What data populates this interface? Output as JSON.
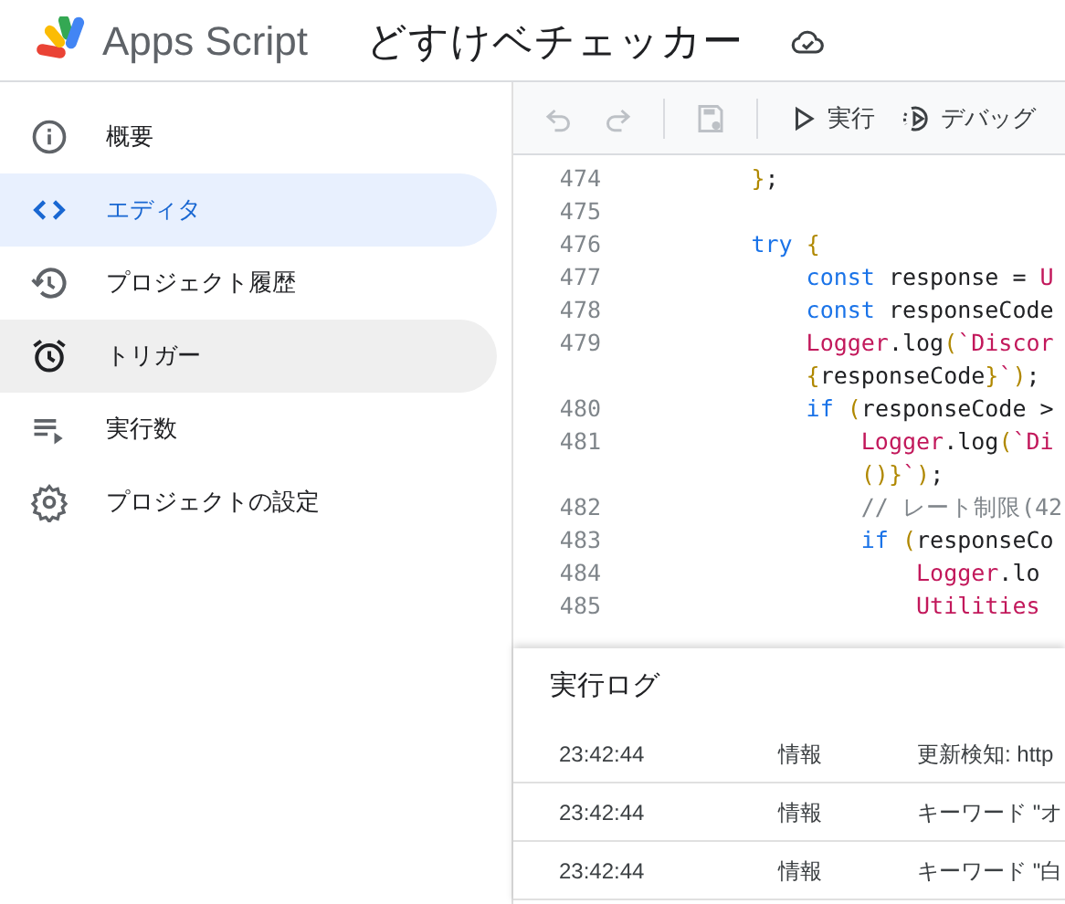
{
  "header": {
    "product": "Apps Script",
    "project_title": "どすけベチェッカー"
  },
  "sidebar": {
    "items": [
      {
        "label": "概要",
        "selected": false
      },
      {
        "label": "エディタ",
        "selected": true
      },
      {
        "label": "プロジェクト履歴",
        "selected": false
      },
      {
        "label": "トリガー",
        "selected": false,
        "hovered": true
      },
      {
        "label": "実行数",
        "selected": false
      },
      {
        "label": "プロジェクトの設定",
        "selected": false
      }
    ]
  },
  "toolbar": {
    "undo": {
      "disabled": true
    },
    "redo": {
      "disabled": true
    },
    "save": {
      "disabled": true
    },
    "run": {
      "label": "実行"
    },
    "debug": {
      "label": "デバッグ"
    }
  },
  "code": {
    "lines": [
      {
        "number": "474",
        "tokens": [
          {
            "kind": "bracket",
            "text": "        }"
          },
          {
            "kind": "plain",
            "text": ";"
          }
        ]
      },
      {
        "number": "475"
      },
      {
        "number": "476",
        "tokens": [
          {
            "kind": "keyword",
            "text": "        try"
          },
          {
            "kind": "bracket",
            "text": " {"
          }
        ]
      },
      {
        "number": "477",
        "tokens": [
          {
            "kind": "keyword",
            "text": "            const"
          },
          {
            "kind": "plain",
            "text": " response = "
          },
          {
            "kind": "ident",
            "text": "U"
          }
        ]
      },
      {
        "number": "478",
        "tokens": [
          {
            "kind": "keyword",
            "text": "            const"
          },
          {
            "kind": "plain",
            "text": " responseCode"
          }
        ]
      },
      {
        "number": "479",
        "tokens": [
          {
            "kind": "ident",
            "text": "            Logger"
          },
          {
            "kind": "plain",
            "text": ".log"
          },
          {
            "kind": "bracket",
            "text": "("
          },
          {
            "kind": "ident",
            "text": "`Discor"
          }
        ]
      },
      {
        "tokens": [
          {
            "kind": "bracket",
            "text": "            {"
          },
          {
            "kind": "plain",
            "text": "responseCode"
          },
          {
            "kind": "bracket",
            "text": "}"
          },
          {
            "kind": "ident",
            "text": "`"
          },
          {
            "kind": "bracket",
            "text": ")"
          },
          {
            "kind": "plain",
            "text": ";"
          }
        ]
      },
      {
        "number": "480",
        "tokens": [
          {
            "kind": "keyword",
            "text": "            if"
          },
          {
            "kind": "bracket",
            "text": " ("
          },
          {
            "kind": "plain",
            "text": "responseCode >"
          }
        ]
      },
      {
        "number": "481",
        "tokens": [
          {
            "kind": "ident",
            "text": "                Logger"
          },
          {
            "kind": "plain",
            "text": ".log"
          },
          {
            "kind": "bracket",
            "text": "("
          },
          {
            "kind": "ident",
            "text": "`Di"
          }
        ]
      },
      {
        "tokens": [
          {
            "kind": "bracket",
            "text": "                ()}"
          },
          {
            "kind": "ident",
            "text": "`"
          },
          {
            "kind": "bracket",
            "text": ")"
          },
          {
            "kind": "plain",
            "text": ";"
          }
        ]
      },
      {
        "number": "482",
        "tokens": [
          {
            "kind": "comment",
            "text": "                // レート制限(42"
          }
        ]
      },
      {
        "number": "483",
        "tokens": [
          {
            "kind": "keyword",
            "text": "                if"
          },
          {
            "kind": "bracket",
            "text": " ("
          },
          {
            "kind": "plain",
            "text": "responseCo"
          }
        ]
      },
      {
        "number": "484",
        "tokens": [
          {
            "kind": "ident",
            "text": "                    Logger"
          },
          {
            "kind": "plain",
            "text": ".lo"
          }
        ]
      },
      {
        "number": "485",
        "tokens": [
          {
            "kind": "ident",
            "text": "                    Utilities"
          }
        ]
      }
    ]
  },
  "log": {
    "title": "実行ログ",
    "rows": [
      {
        "time": "23:42:44",
        "level": "情報",
        "message": "更新検知: http"
      },
      {
        "time": "23:42:44",
        "level": "情報",
        "message": "キーワード \"オ"
      },
      {
        "time": "23:42:44",
        "level": "情報",
        "message": "キーワード \"白"
      }
    ]
  }
}
